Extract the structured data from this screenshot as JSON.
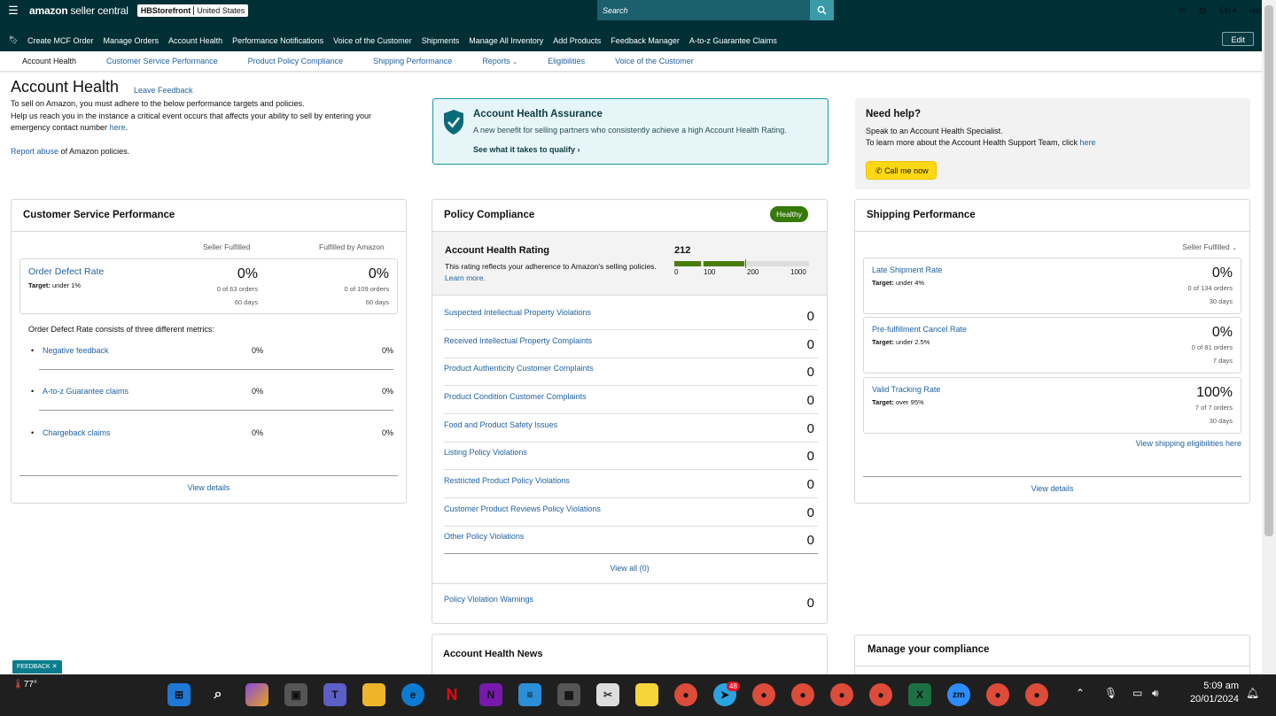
{
  "topbar": {
    "logo": "amazon",
    "logo_sub": "seller central",
    "store_name": "HBStorefront",
    "store_region": "United States",
    "search_placeholder": "Search",
    "lang": "EN",
    "help": "Help"
  },
  "nav": {
    "items": [
      "Create MCF Order",
      "Manage Orders",
      "Account Health",
      "Performance Notifications",
      "Voice of the Customer",
      "Shipments",
      "Manage All Inventory",
      "Add Products",
      "Feedback Manager",
      "A-to-z Guarantee Claims"
    ],
    "edit": "Edit"
  },
  "subnav": {
    "items": [
      "Account Health",
      "Customer Service Performance",
      "Product Policy Compliance",
      "Shipping Performance",
      "Reports",
      "Eligibilities",
      "Voice of the Customer"
    ]
  },
  "header": {
    "title": "Account Health",
    "leave_feedback": "Leave Feedback",
    "intro1": "To sell on Amazon, you must adhere to the below performance targets and policies.",
    "intro2": "Help us reach you in the instance a critical event occurs that affects your ability to sell by entering your emergency contact number",
    "here": "here",
    "report_abuse": "Report abuse",
    "report_abuse_tail": "of Amazon policies."
  },
  "aha": {
    "title": "Account Health Assurance",
    "desc": "A new benefit for selling partners who consistently achieve a high Account Health Rating.",
    "cta": "See what it takes to qualify"
  },
  "help": {
    "title": "Need help?",
    "line1": "Speak to an Account Health Specialist.",
    "line2": "To learn more about the Account Health Support Team, click",
    "here": "here",
    "call": "Call me now"
  },
  "csp": {
    "title": "Customer Service Performance",
    "col1": "Seller Fulfilled",
    "col2": "Fulfilled by Amazon",
    "odr_label": "Order Defect Rate",
    "odr_target": "Target:",
    "odr_target_val": "under 1%",
    "sf_val": "0%",
    "sf_orders": "0 of 63 orders",
    "sf_days": "60 days",
    "fba_val": "0%",
    "fba_orders": "0 of 109 orders",
    "fba_days": "60 days",
    "three_metrics": "Order Defect Rate consists of three different metrics:",
    "metrics": [
      {
        "label": "Negative feedback",
        "sf": "0%",
        "fba": "0%"
      },
      {
        "label": "A-to-z Guarantee claims",
        "sf": "0%",
        "fba": "0%"
      },
      {
        "label": "Chargeback claims",
        "sf": "0%",
        "fba": "0%"
      }
    ],
    "view_details": "View details"
  },
  "policy": {
    "title": "Policy Compliance",
    "badge": "Healthy",
    "ahr_title": "Account Health Rating",
    "ahr_desc": "This rating reflects your adherence to Amazon's selling policies.",
    "learn_more": "Learn more.",
    "ahr_value": "212",
    "ahr_value_num": 212,
    "scale": [
      "0",
      "100",
      "200",
      "1000"
    ],
    "rows": [
      {
        "label": "Suspected Intellectual Property Violations",
        "value": "0"
      },
      {
        "label": "Received Intellectual Property Complaints",
        "value": "0"
      },
      {
        "label": "Product Authenticity Customer Complaints",
        "value": "0"
      },
      {
        "label": "Product Condition Customer Complaints",
        "value": "0"
      },
      {
        "label": "Food and Product Safety Issues",
        "value": "0"
      },
      {
        "label": "Listing Policy Violations",
        "value": "0"
      },
      {
        "label": "Restricted Product Policy Violations",
        "value": "0"
      },
      {
        "label": "Customer Product Reviews Policy Violations",
        "value": "0"
      },
      {
        "label": "Other Policy Violations",
        "value": "0"
      }
    ],
    "view_all": "View all (0)",
    "warnings_label": "Policy Violation Warnings",
    "warnings_value": "0"
  },
  "shipping": {
    "title": "Shipping Performance",
    "filter": "Seller Fulfilled",
    "metrics": [
      {
        "label": "Late Shipment Rate",
        "target": "Target:",
        "target_val": "under 4%",
        "value": "0%",
        "orders": "0 of 134 orders",
        "days": "30 days"
      },
      {
        "label": "Pre-fulfillment Cancel Rate",
        "target": "Target:",
        "target_val": "under 2.5%",
        "value": "0%",
        "orders": "0 of 81 orders",
        "days": "7 days"
      },
      {
        "label": "Valid Tracking Rate",
        "target": "Target:",
        "target_val": "over 95%",
        "value": "100%",
        "orders": "7 of 7 orders",
        "days": "30 days"
      }
    ],
    "eligibilities": "View shipping eligibilities here",
    "view_details": "View details"
  },
  "news": {
    "title": "Account Health News"
  },
  "compliance": {
    "title": "Manage your compliance"
  },
  "feedback_tab": "FEEDBACK ✕",
  "taskbar": {
    "weather": "77°",
    "time": "5:09 am",
    "date": "20/01/2024",
    "badge": "48"
  }
}
